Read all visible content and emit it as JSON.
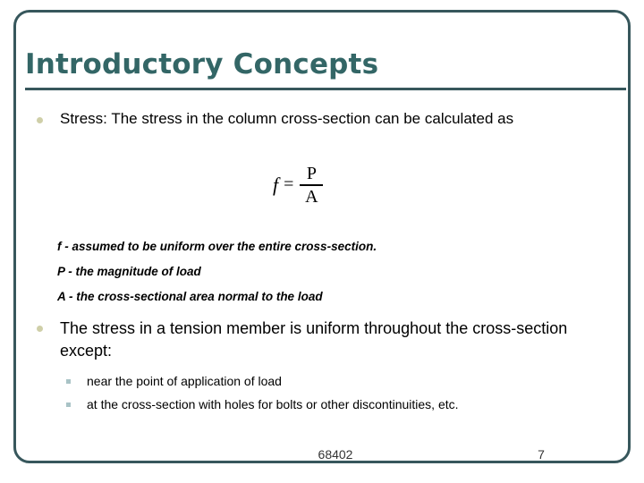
{
  "slide": {
    "title": "Introductory Concepts",
    "accent_color": "#336666",
    "frame_color": "#37575c",
    "bullet_color": "#cfcfa8",
    "sub_bullet_color": "#a9c3c6",
    "background": "#ffffff"
  },
  "body": {
    "bullets": [
      {
        "marker": "dot-bullet-icon",
        "text": "Stress: The stress in the column cross-section can be calculated as"
      },
      {
        "marker": "dot-bullet-icon",
        "text": "The stress in a tension member is uniform throughout the cross-section except:"
      }
    ],
    "sub_bullets": [
      {
        "marker": "square-bullet-icon",
        "text": "near the point of application of load"
      },
      {
        "marker": "square-bullet-icon",
        "text": "at the cross-section with holes for bolts or other discontinuities, etc."
      }
    ]
  },
  "equation": {
    "lhs": "f",
    "operator": "=",
    "numerator": "P",
    "denominator": "A"
  },
  "definitions": [
    "f - assumed to be uniform over the entire cross-section.",
    "P - the magnitude of load",
    "A - the cross-sectional area normal to the load"
  ],
  "footer": {
    "course_code": "68402",
    "page_number": "7"
  }
}
